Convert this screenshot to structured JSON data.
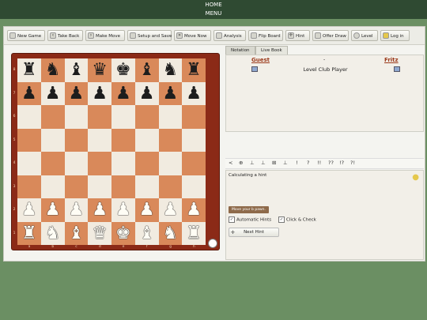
{
  "topnav": {
    "home": "HOME",
    "menu": "MENU"
  },
  "toolbar": {
    "new_game": "New Game",
    "take_back": "Take Back",
    "make_move": "Make Move",
    "setup_save": "Setup and Save",
    "move_now": "Move Now",
    "analysis": "Analysis",
    "flip_board": "Flip Board",
    "hint": "Hint",
    "offer_draw": "Offer Draw",
    "level": "Level",
    "log_in": "Log in"
  },
  "board": {
    "ranks": [
      "8",
      "7",
      "6",
      "5",
      "4",
      "3",
      "2",
      "1"
    ],
    "files": [
      "a",
      "b",
      "c",
      "d",
      "e",
      "f",
      "g",
      "h"
    ],
    "position": [
      [
        "br",
        "bn",
        "bb",
        "bq",
        "bk",
        "bb",
        "bn",
        "br"
      ],
      [
        "bp",
        "bp",
        "bp",
        "bp",
        "bp",
        "bp",
        "bp",
        "bp"
      ],
      [
        "",
        "",
        "",
        "",
        "",
        "",
        "",
        ""
      ],
      [
        "",
        "",
        "",
        "",
        "",
        "",
        "",
        ""
      ],
      [
        "",
        "",
        "",
        "",
        "",
        "",
        "",
        ""
      ],
      [
        "",
        "",
        "",
        "",
        "",
        "",
        "",
        ""
      ],
      [
        "wp",
        "wp",
        "wp",
        "wp",
        "wp",
        "wp",
        "wp",
        "wp"
      ],
      [
        "wr",
        "wn",
        "wb",
        "wq",
        "wk",
        "wb",
        "wn",
        "wr"
      ]
    ],
    "light_color": "#f1ebe0",
    "dark_color": "#d9895a",
    "frame_color": "#8b2a17"
  },
  "tabs": {
    "notation": "Notation",
    "live_book": "Live Book"
  },
  "notation": {
    "white_player": "Guest",
    "black_player": "Fritz",
    "separator": "-",
    "level": "Level Club Player"
  },
  "symbols": [
    "<",
    "⊕",
    "⊥",
    "⊥",
    "⊞",
    "⊥",
    "!",
    "?",
    "!!",
    "??",
    "!?",
    "?!"
  ],
  "hint_panel": {
    "title": "Calculating a hint",
    "move_button": "Move your b pawn.",
    "auto_hints": "Automatic Hints",
    "click_check": "Click & Check",
    "next_hint": "Next Hint"
  }
}
